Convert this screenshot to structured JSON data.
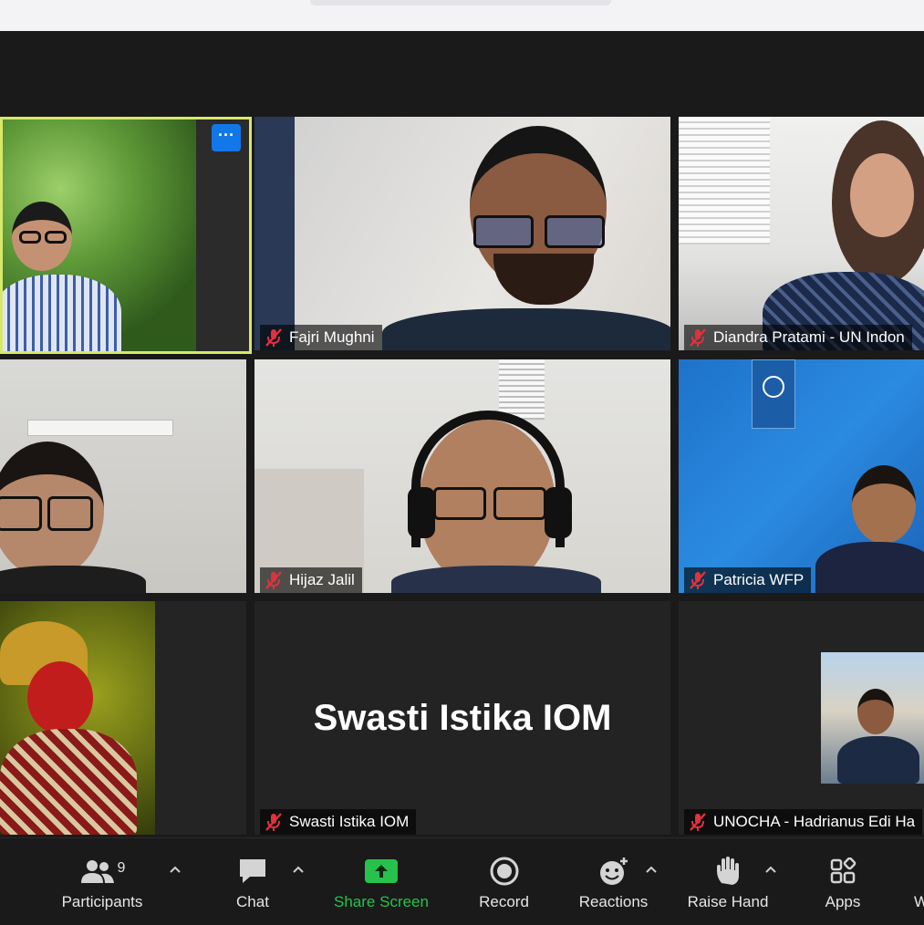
{
  "participants": [
    {
      "name": ""
    },
    {
      "name": "Fajri Mughni"
    },
    {
      "name": "Diandra Pratami - UN Indon"
    },
    {
      "name": ""
    },
    {
      "name": "Hijaz Jalil"
    },
    {
      "name": "Patricia WFP"
    },
    {
      "name": ""
    },
    {
      "name": "Swasti Istika IOM",
      "display_text": "Swasti Istika IOM"
    },
    {
      "name": "UNOCHA - Hadrianus Edi Ha"
    }
  ],
  "more_label": "···",
  "toolbar": {
    "participants_label": "Participants",
    "participants_count": "9",
    "chat_label": "Chat",
    "share_label": "Share Screen",
    "record_label": "Record",
    "reactions_label": "Reactions",
    "raise_label": "Raise Hand",
    "apps_label": "Apps",
    "cutoff_label": "W"
  },
  "colors": {
    "spotlight_border": "#d8e86a",
    "share_green": "#27c24c",
    "more_button": "#1277e8",
    "mute_red": "#e0323c"
  },
  "icons": [
    "microphone-muted-icon",
    "participants-icon",
    "chat-icon",
    "share-screen-icon",
    "record-icon",
    "reactions-icon",
    "raise-hand-icon",
    "apps-icon",
    "chevron-up-icon",
    "more-icon"
  ]
}
